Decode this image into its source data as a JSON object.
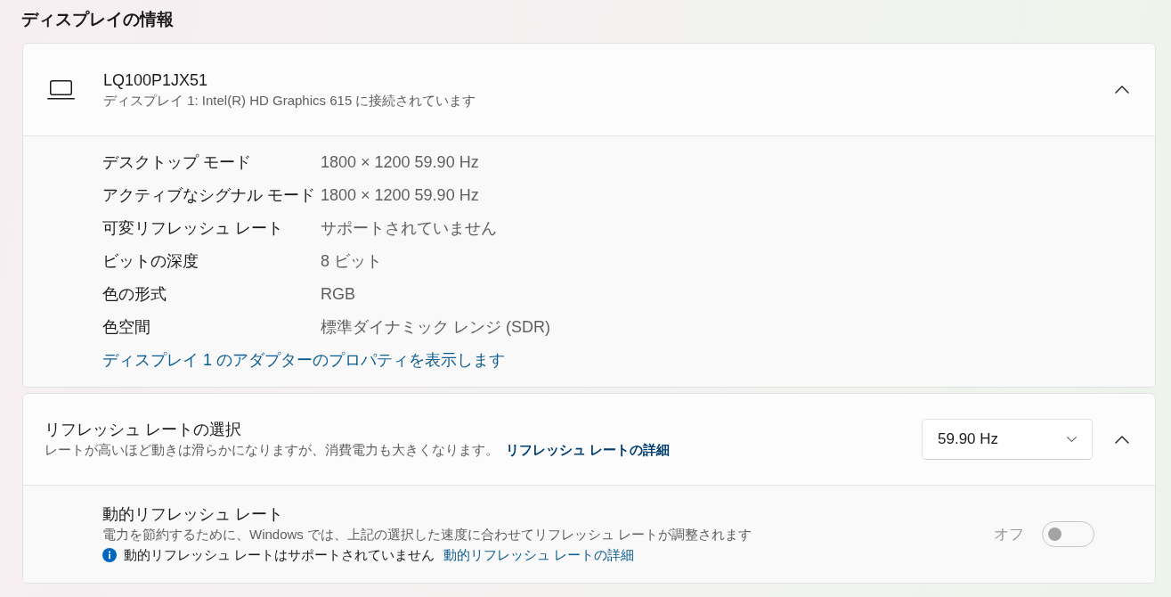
{
  "section_title": "ディスプレイの情報",
  "display_card": {
    "name": "LQ100P1JX51",
    "subtitle": "ディスプレイ 1: Intel(R) HD Graphics 615 に接続されています",
    "expanded": true,
    "properties": [
      {
        "label": "デスクトップ モード",
        "value": "1800 × 1200 59.90 Hz"
      },
      {
        "label": "アクティブなシグナル モード",
        "value": "1800 × 1200 59.90 Hz"
      },
      {
        "label": "可変リフレッシュ レート",
        "value": "サポートされていません"
      },
      {
        "label": "ビットの深度",
        "value": "8 ビット"
      },
      {
        "label": "色の形式",
        "value": "RGB"
      },
      {
        "label": "色空間",
        "value": "標準ダイナミック レンジ (SDR)"
      }
    ],
    "link": "ディスプレイ 1 のアダプターのプロパティを表示します"
  },
  "refresh_card": {
    "title": "リフレッシュ レートの選択",
    "description": "レートが高いほど動きは滑らかになりますが、消費電力も大きくなります。",
    "link": "リフレッシュ レートの詳細",
    "dropdown": {
      "value": "59.90 Hz"
    },
    "expanded": true,
    "dynamic_refresh": {
      "title": "動的リフレッシュ レート",
      "description": "電力を節約するために、Windows では、上記の選択した速度に合わせてリフレッシュ レートが調整されます",
      "notice": "動的リフレッシュ レートはサポートされていません",
      "notice_link": "動的リフレッシュ レートの詳細",
      "toggle": {
        "label": "オフ",
        "on": false,
        "disabled": true
      }
    }
  }
}
